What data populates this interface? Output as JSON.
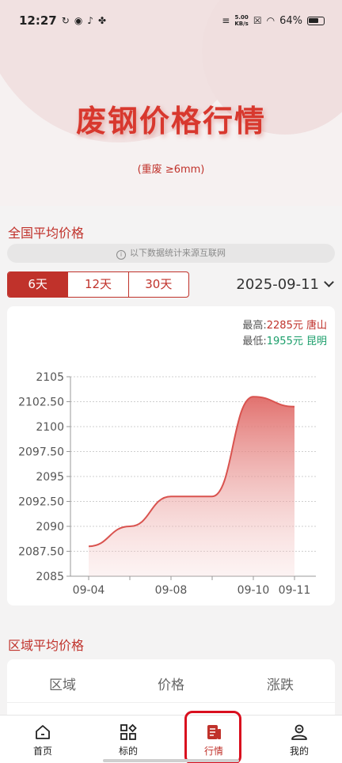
{
  "status_bar": {
    "time": "12:27",
    "net_speed_value": "5.00",
    "net_speed_unit": "KB/s",
    "battery": "64%"
  },
  "hero": {
    "title": "废钢价格行情",
    "subtitle": "(重废 ≥6mm)"
  },
  "national": {
    "section_title": "全国平均价格",
    "notice": "以下数据统计来源互联网",
    "tabs": [
      "6天",
      "12天",
      "30天"
    ],
    "active_tab": 0,
    "date": "2025-09-11",
    "high_label": "最高:",
    "high_value": "2285元",
    "high_city": "唐山",
    "low_label": "最低:",
    "low_value": "1955元",
    "low_city": "昆明"
  },
  "chart_data": {
    "type": "area",
    "x": [
      "09-04",
      "09-06",
      "09-08",
      "09-09",
      "09-10",
      "09-11"
    ],
    "y": [
      2088,
      2090,
      2093,
      2093,
      2103,
      2102
    ],
    "x_tick_labels": [
      "09-04",
      "09-08",
      "09-10",
      "09-11"
    ],
    "y_ticks": [
      "2085",
      "2087.50",
      "2090",
      "2092.50",
      "2095",
      "2097.50",
      "2100",
      "2102.50",
      "2105"
    ],
    "ylim": [
      2085,
      2105
    ],
    "grid": "horizontal dashed",
    "line_color": "#d9534f"
  },
  "regional": {
    "section_title": "区域平均价格",
    "headers": [
      "区域",
      "价格",
      "涨跌"
    ]
  },
  "tabbar": {
    "items": [
      "首页",
      "标的",
      "行情",
      "我的"
    ],
    "active": 2
  },
  "colors": {
    "primary": "#c0322b",
    "up_red": "#c0322b",
    "down_green": "#1a9e6a"
  }
}
